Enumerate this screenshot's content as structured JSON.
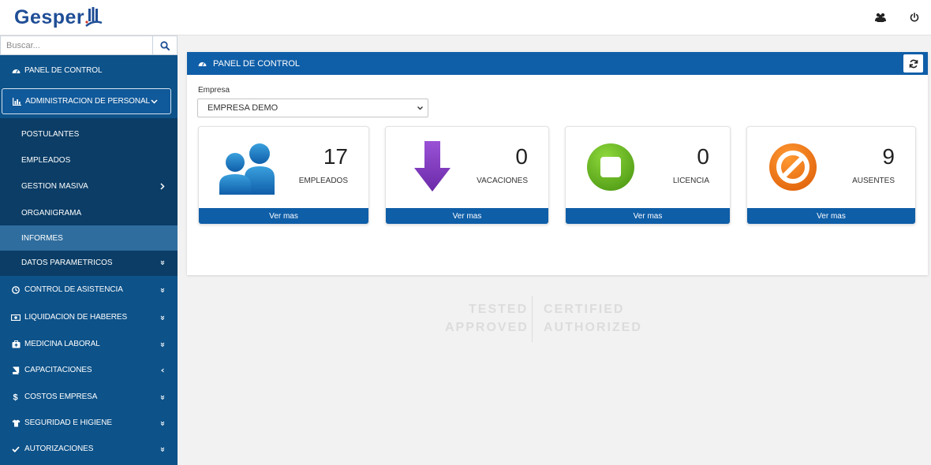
{
  "app": {
    "logo_text": "Gesper"
  },
  "colors": {
    "primary": "#0f5ea8",
    "sidebar": "#0d5289",
    "submenu": "#0b3d66",
    "accent_purple": "#7a36b8",
    "accent_green": "#6dbb24",
    "accent_orange": "#ee7b12"
  },
  "search": {
    "placeholder": "Buscar..."
  },
  "sidebar": {
    "items": [
      {
        "label": "PANEL DE CONTROL",
        "icon": "dashboard-icon"
      },
      {
        "label": "ADMINISTRACION DE PERSONAL",
        "icon": "bar-chart-icon"
      },
      {
        "label": "CONTROL DE ASISTENCIA",
        "icon": "clock-icon"
      },
      {
        "label": "LIQUIDACION DE HABERES",
        "icon": "money-icon"
      },
      {
        "label": "MEDICINA LABORAL",
        "icon": "medkit-icon"
      },
      {
        "label": "CAPACITACIONES",
        "icon": "book-icon"
      },
      {
        "label": "COSTOS EMPRESA",
        "icon": "dollar-icon"
      },
      {
        "label": "SEGURIDAD E HIGIENE",
        "icon": "shirt-icon"
      },
      {
        "label": "AUTORIZACIONES",
        "icon": "check-icon"
      }
    ],
    "subitems": [
      {
        "label": "POSTULANTES"
      },
      {
        "label": "EMPLEADOS"
      },
      {
        "label": "GESTION MASIVA"
      },
      {
        "label": "ORGANIGRAMA"
      },
      {
        "label": "INFORMES"
      },
      {
        "label": "DATOS PARAMETRICOS"
      }
    ]
  },
  "panel": {
    "title": "PANEL DE CONTROL",
    "empresa_label": "Empresa",
    "empresa_value": "EMPRESA DEMO",
    "cards": [
      {
        "value": "17",
        "label": "EMPLEADOS",
        "link": "Ver mas",
        "icon": "users-icon"
      },
      {
        "value": "0",
        "label": "VACACIONES",
        "link": "Ver mas",
        "icon": "arrow-down-icon"
      },
      {
        "value": "0",
        "label": "LICENCIA",
        "link": "Ver mas",
        "icon": "stop-icon"
      },
      {
        "value": "9",
        "label": "AUSENTES",
        "link": "Ver mas",
        "icon": "ban-icon"
      }
    ]
  },
  "watermark": {
    "line1_left": "TESTED",
    "line1_right": "CERTIFIED",
    "line2_left": "APPROVED",
    "line2_right": "AUTHORIZED"
  }
}
